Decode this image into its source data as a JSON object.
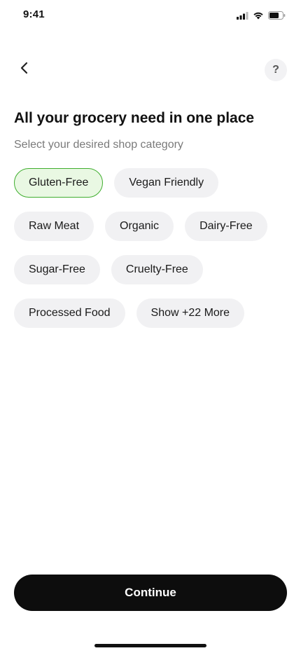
{
  "status_bar": {
    "time": "9:41"
  },
  "header": {
    "back_icon": "chevron-left-icon",
    "help_label": "?"
  },
  "main": {
    "title": "All your grocery need in one place",
    "subtitle": "Select your desired shop category",
    "categories": [
      {
        "label": "Gluten-Free",
        "selected": true
      },
      {
        "label": "Vegan Friendly",
        "selected": false
      },
      {
        "label": "Raw Meat",
        "selected": false
      },
      {
        "label": "Organic",
        "selected": false
      },
      {
        "label": "Dairy-Free",
        "selected": false
      },
      {
        "label": "Sugar-Free",
        "selected": false
      },
      {
        "label": "Cruelty-Free",
        "selected": false
      },
      {
        "label": "Processed Food",
        "selected": false
      },
      {
        "label": "Show +22 More",
        "selected": false
      }
    ]
  },
  "footer": {
    "continue_label": "Continue"
  },
  "colors": {
    "selected_chip_bg": "#e9f8e3",
    "selected_chip_border": "#3fae2e",
    "chip_bg": "#f1f1f3",
    "primary_button": "#0d0d0d"
  }
}
